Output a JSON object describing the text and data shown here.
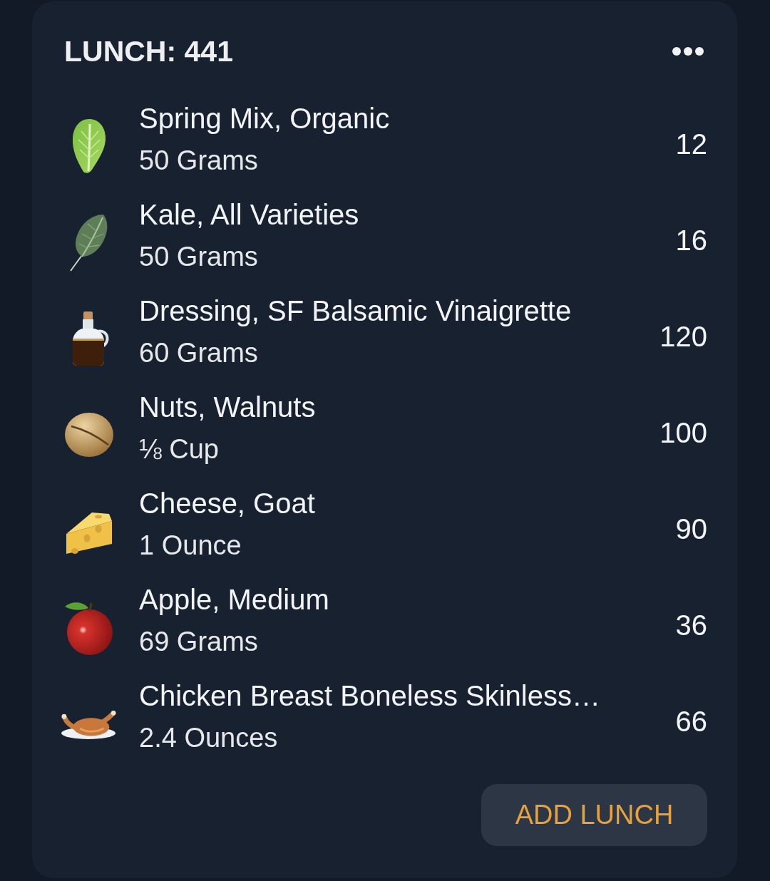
{
  "card": {
    "title": "LUNCH: 441",
    "foods": [
      {
        "kind": "lettuce",
        "name": "Spring Mix, Organic",
        "serving": "50 Grams",
        "calories": "12"
      },
      {
        "kind": "leaf",
        "name": "Kale, All Varieties",
        "serving": "50 Grams",
        "calories": "16"
      },
      {
        "kind": "bottle",
        "name": "Dressing, SF Balsamic Vinaigrette",
        "serving": "60 Grams",
        "calories": "120"
      },
      {
        "kind": "nut",
        "name": "Nuts, Walnuts",
        "serving": "⅛ Cup",
        "calories": "100"
      },
      {
        "kind": "cheese",
        "name": "Cheese, Goat",
        "serving": "1 Ounce",
        "calories": "90"
      },
      {
        "kind": "apple",
        "name": "Apple, Medium",
        "serving": "69 Grams",
        "calories": "36"
      },
      {
        "kind": "chicken",
        "name": "Chicken Breast Boneless Skinless…",
        "serving": "2.4 Ounces",
        "calories": "66"
      }
    ],
    "button": "ADD LUNCH"
  }
}
